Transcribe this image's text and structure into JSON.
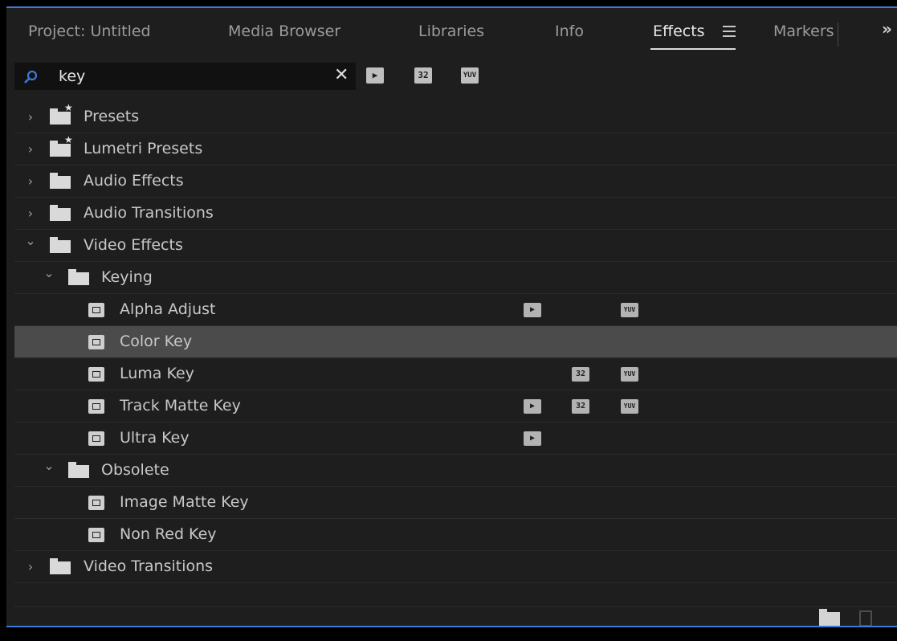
{
  "tabs": [
    {
      "label": "Project: Untitled",
      "active": false
    },
    {
      "label": "Media Browser",
      "active": false
    },
    {
      "label": "Libraries",
      "active": false
    },
    {
      "label": "Info",
      "active": false
    },
    {
      "label": "Effects",
      "active": true
    },
    {
      "label": "Markers",
      "active": false
    }
  ],
  "overflow_label": "»",
  "search": {
    "value": "key",
    "clear_icon": "close-icon"
  },
  "filters": [
    {
      "name": "accelerated-effects-filter",
      "text": "▶"
    },
    {
      "name": "32-bit-filter",
      "text": "32"
    },
    {
      "name": "yuv-filter",
      "text": "YUV"
    }
  ],
  "tree": [
    {
      "label": "Presets",
      "type": "preset-folder",
      "level": 0,
      "expanded": false
    },
    {
      "label": "Lumetri Presets",
      "type": "preset-folder",
      "level": 0,
      "expanded": false
    },
    {
      "label": "Audio Effects",
      "type": "folder",
      "level": 0,
      "expanded": false
    },
    {
      "label": "Audio Transitions",
      "type": "folder",
      "level": 0,
      "expanded": false
    },
    {
      "label": "Video Effects",
      "type": "folder",
      "level": 0,
      "expanded": true
    },
    {
      "label": "Keying",
      "type": "folder",
      "level": 1,
      "expanded": true
    },
    {
      "label": "Alpha Adjust",
      "type": "effect",
      "level": 2,
      "accel": true,
      "b32": false,
      "yuv": true
    },
    {
      "label": "Color Key",
      "type": "effect",
      "level": 2,
      "accel": false,
      "b32": false,
      "yuv": false,
      "selected": true
    },
    {
      "label": "Luma Key",
      "type": "effect",
      "level": 2,
      "accel": false,
      "b32": true,
      "yuv": true
    },
    {
      "label": "Track Matte Key",
      "type": "effect",
      "level": 2,
      "accel": true,
      "b32": true,
      "yuv": true
    },
    {
      "label": "Ultra Key",
      "type": "effect",
      "level": 2,
      "accel": true,
      "b32": false,
      "yuv": false
    },
    {
      "label": "Obsolete",
      "type": "folder",
      "level": 1,
      "expanded": true
    },
    {
      "label": "Image Matte Key",
      "type": "effect",
      "level": 2
    },
    {
      "label": "Non Red Key",
      "type": "effect",
      "level": 2
    },
    {
      "label": "Video Transitions",
      "type": "folder",
      "level": 0,
      "expanded": false
    }
  ],
  "badges": {
    "accel": "▶",
    "b32": "32",
    "yuv": "YUV"
  },
  "colors": {
    "accent": "#3d7ad6",
    "panel": "#1e1e1e",
    "selected_row": "#4b4b4b"
  }
}
